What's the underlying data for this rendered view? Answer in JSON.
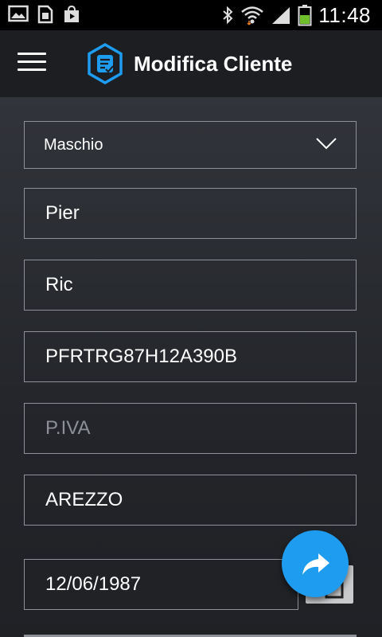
{
  "status_bar": {
    "time": "11:48",
    "icons_left": [
      "gallery-icon",
      "sim-card-icon",
      "play-store-icon"
    ],
    "icons_right": [
      "bluetooth-icon",
      "wifi-icon",
      "signal-icon",
      "battery-icon"
    ]
  },
  "app_bar": {
    "title": "Modifica Cliente",
    "menu_icon": "hamburger-menu-icon",
    "logo_icon": "hexagon-document-logo"
  },
  "form": {
    "gender": {
      "value": "Maschio"
    },
    "first_name": {
      "value": "Pier"
    },
    "last_name": {
      "value": "Ric"
    },
    "fiscal_code": {
      "value": "PFRTRG87H12A390B"
    },
    "vat_number": {
      "value": "",
      "placeholder": "P.IVA"
    },
    "city": {
      "value": "AREZZO"
    },
    "birth_date": {
      "value": "12/06/1987"
    }
  },
  "fab": {
    "icon": "share-forward-icon",
    "color": "#1e9cf0"
  },
  "colors": {
    "accent": "#1e9cf0",
    "app_bar": "#1c1e22",
    "status_bar": "#000000"
  }
}
